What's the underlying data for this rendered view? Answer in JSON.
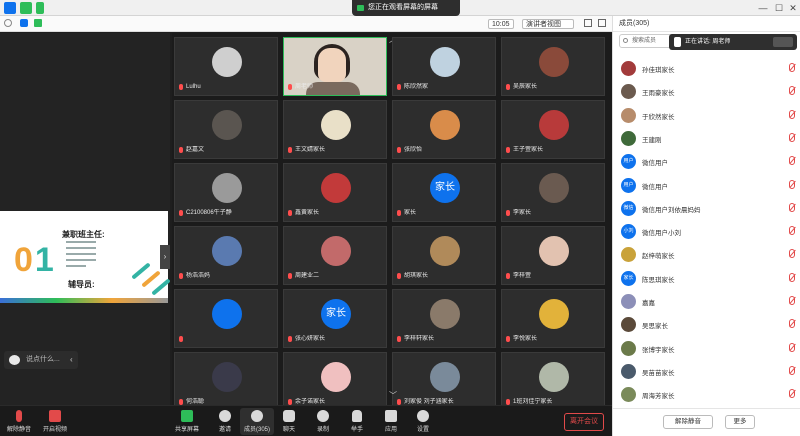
{
  "window": {
    "sharing_label": "您正在观看屏幕的屏幕",
    "view_label": "演讲者视图",
    "time": "10:05"
  },
  "participants_panel": {
    "title": "成员(305)",
    "search_placeholder": "搜索成员",
    "speaker_popup": "正在讲话: 周老师",
    "mute_all": "解除静音",
    "more": "更多",
    "members": [
      {
        "name": "孙佳琪家长",
        "avatar": "",
        "color": "#a23b3b"
      },
      {
        "name": "王雨豪家长",
        "avatar": "",
        "color": "#6b5a4e"
      },
      {
        "name": "于欣然家长",
        "avatar": "",
        "color": "#b78c6b"
      },
      {
        "name": "王建刚",
        "avatar": "",
        "color": "#3f6a3a"
      },
      {
        "name": "微信用户",
        "avatar": "用户",
        "color": "#0e72ed"
      },
      {
        "name": "微信用户",
        "avatar": "用户",
        "color": "#0e72ed"
      },
      {
        "name": "微信用户刘依晨妈妈",
        "avatar": "微信",
        "color": "#0e72ed"
      },
      {
        "name": "微信用户小刘",
        "avatar": "小刘",
        "color": "#0e72ed"
      },
      {
        "name": "赵梓萌家长",
        "avatar": "",
        "color": "#c9a23a"
      },
      {
        "name": "陈思琪家长",
        "avatar": "家长",
        "color": "#0e72ed"
      },
      {
        "name": "嘉嘉",
        "avatar": "",
        "color": "#8c8fb8"
      },
      {
        "name": "吴思家长",
        "avatar": "",
        "color": "#5b4a3a"
      },
      {
        "name": "张博宇家长",
        "avatar": "",
        "color": "#6b7a4a"
      },
      {
        "name": "吴苗苗家长",
        "avatar": "",
        "color": "#4a5a6b"
      },
      {
        "name": "周海芳家长",
        "avatar": "",
        "color": "#7a8a5a"
      }
    ]
  },
  "shared_slide": {
    "number_digit0": "0",
    "number_digit1": "1",
    "title": "兼职班主任:",
    "subtitle": "辅导员:"
  },
  "chat_hint": {
    "text": "说点什么..."
  },
  "gallery": {
    "tiles": [
      {
        "name": "Lulhu",
        "avatar": "",
        "color": "#cfcfcf"
      },
      {
        "name": "周老师",
        "avatar": "",
        "color": "#d9d2c6",
        "video": true
      },
      {
        "name": "陈欣然家",
        "avatar": "",
        "color": "#bfd2e0"
      },
      {
        "name": "吴辰家长",
        "avatar": "",
        "color": "#8a4a3a"
      },
      {
        "name": "赵嘉文",
        "avatar": "",
        "color": "#5a5550"
      },
      {
        "name": "王文婧家长",
        "avatar": "",
        "color": "#e9e0c8"
      },
      {
        "name": "张欣怡",
        "avatar": "",
        "color": "#d98c4a"
      },
      {
        "name": "王子萱家长",
        "avatar": "",
        "color": "#b83a3a"
      },
      {
        "name": "C2100806牛子静",
        "avatar": "",
        "color": "#9a9a9a"
      },
      {
        "name": "鑫黄家长",
        "avatar": "",
        "color": "#c23a3a"
      },
      {
        "name": "家长",
        "avatar": "家长",
        "color": "#0e72ed"
      },
      {
        "name": "李家长",
        "avatar": "",
        "color": "#6a5a50"
      },
      {
        "name": "杨浩浩妈",
        "avatar": "",
        "color": "#5a7ab0"
      },
      {
        "name": "周建业二",
        "avatar": "",
        "color": "#c26a6a"
      },
      {
        "name": "胡琪家长",
        "avatar": "",
        "color": "#b08a5a"
      },
      {
        "name": "李梓萱",
        "avatar": "",
        "color": "#e2c2b0"
      },
      {
        "name": "",
        "avatar": "",
        "color": "#0e72ed"
      },
      {
        "name": "张心妍家长",
        "avatar": "家长",
        "color": "#0e72ed"
      },
      {
        "name": "李梓轩家长",
        "avatar": "",
        "color": "#8a7a6a"
      },
      {
        "name": "李悦家长",
        "avatar": "",
        "color": "#e2b23a"
      },
      {
        "name": "何浩聪",
        "avatar": "",
        "color": "#3a3a4a"
      },
      {
        "name": "余子诺家长",
        "avatar": "",
        "color": "#f0c0c0"
      },
      {
        "name": "刘家俊 刘子涵家长",
        "avatar": "",
        "color": "#7a8a9a"
      },
      {
        "name": "1班刘佳宁家长",
        "avatar": "",
        "color": "#b0b8a8"
      }
    ]
  },
  "toolbar": {
    "mute": "解除静音",
    "video": "开启视频",
    "share": "共享屏幕",
    "invite": "邀请",
    "members": "成员(305)",
    "chat": "聊天",
    "record": "录制",
    "hands": "举手",
    "apps": "应用",
    "settings": "设置",
    "leave": "离开会议"
  }
}
